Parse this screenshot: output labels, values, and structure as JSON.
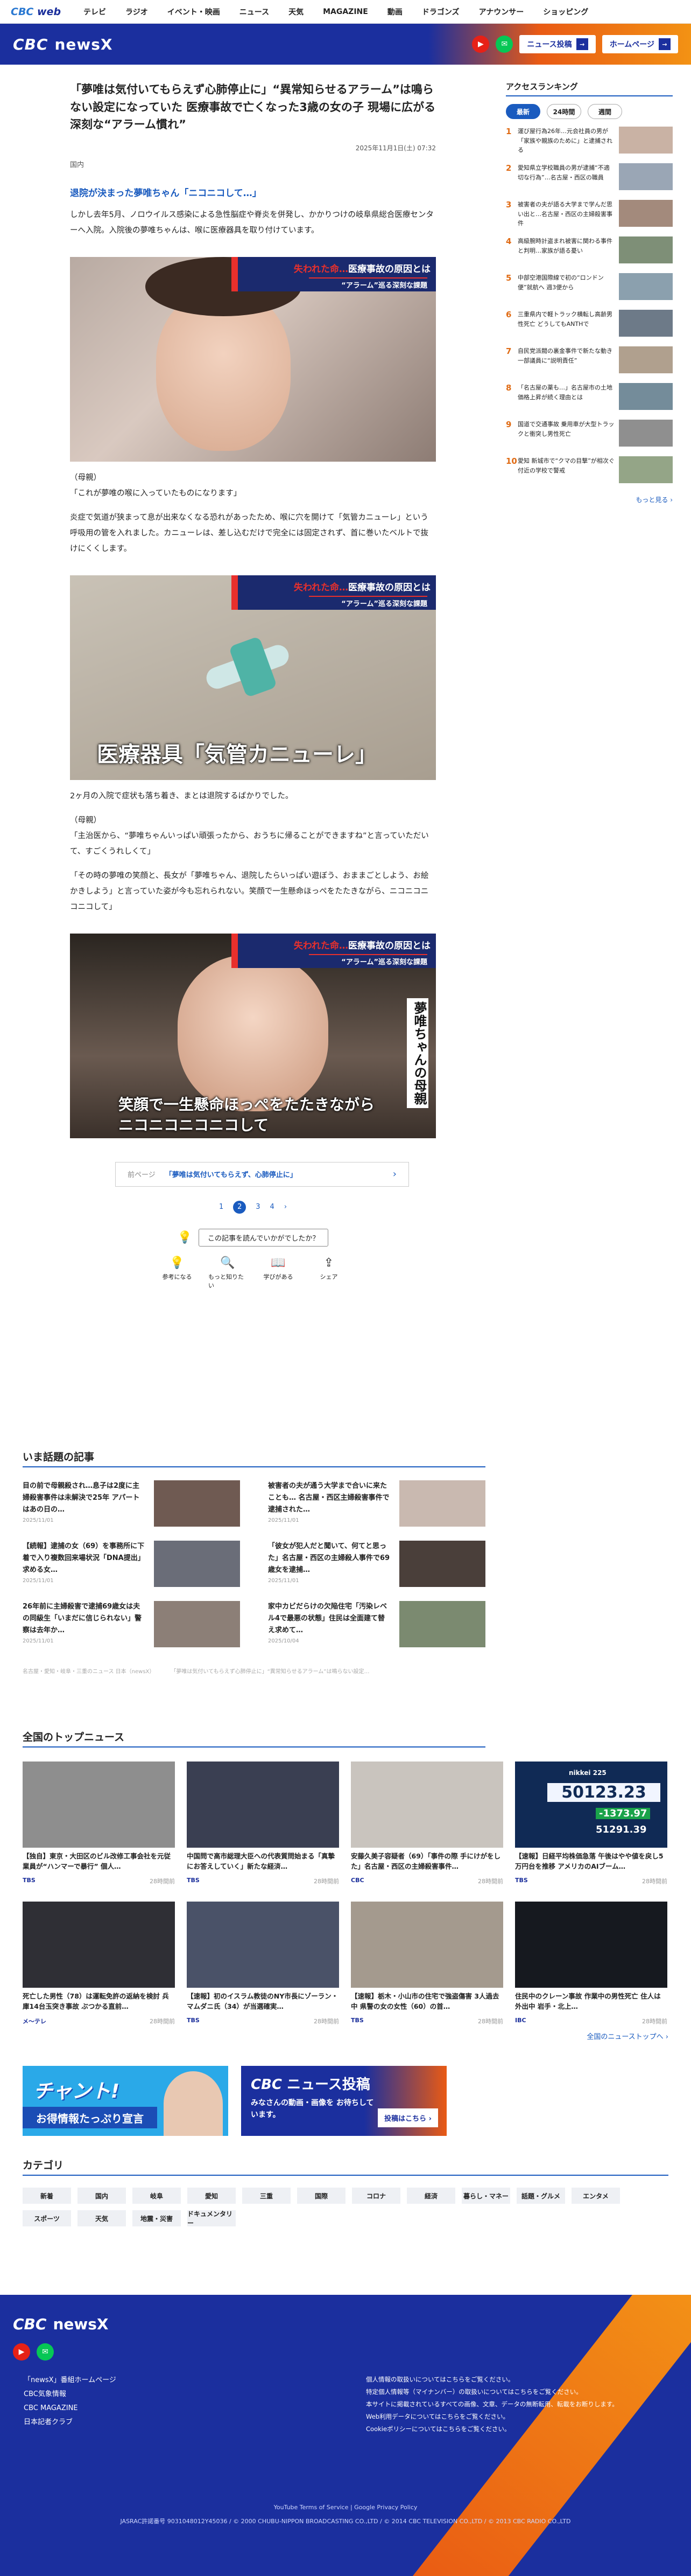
{
  "topbar": {
    "logo_main": "CBC",
    "logo_sub": "web",
    "nav": [
      "テレビ",
      "ラジオ",
      "イベント・映画",
      "ニュース",
      "天気",
      "MAGAZINE",
      "動画",
      "ドラゴンズ",
      "アナウンサー",
      "ショッピング"
    ]
  },
  "header": {
    "brand": "CBC",
    "brand_sub": "newsX",
    "post_button": "ニュース投稿",
    "home_button": "ホームページ"
  },
  "article": {
    "title": "「夢唯は気付いてもらえず心肺停止に」“異常知らせるアラーム”は鳴らない設定になっていた 医療事故で亡くなった3歳の女の子 現場に広がる深刻な“アラーム慣れ”",
    "date": "2025年11月1日(土) 07:32",
    "source": "国内",
    "lead": "退院が決まった夢唯ちゃん「ニコニコして…」",
    "p1": "しかし去年5月、ノロウイルス感染による急性脳症や脊炎を併発し、かかりつけの岐阜県総合医療センターへ入院。入院後の夢唯ちゃんは、喉に医療器具を取り付けています。",
    "photo1_banner_a": "失われた命…",
    "photo1_banner_b": "医療事故の原因とは",
    "photo1_banner_c": "“アラーム”巡る深刻な課題",
    "p2": "（母親）\n「これが夢唯の喉に入っていたものになります」",
    "p3": "炎症で気道が狭まって息が出来なくなる恐れがあったため、喉に穴を開けて「気管カニューレ」という呼吸用の管を入れました。カニューレは、差し込むだけで完全には固定されず、首に巻いたベルトで抜けにくくします。",
    "photo2_caption": "医療器具「気管カニューレ」",
    "p4": "2ヶ月の入院で症状も落ち着き、まとは退院するばかりでした。",
    "p5": "（母親）\n「主治医から、“夢唯ちゃんいっぱい頑張ったから、おうちに帰ることができますね”と言っていただいて、すごくうれしくて」",
    "p6": "「その時の夢唯の笑顔と、長女が「夢唯ちゃん、退院したらいっぱい遊ぼう、おままごとしよう、お絵かきしよう」と言っていた姿が今も忘れられない。笑顔で一生懸命ほっぺをたたきながら、ニコニコニコニコして」",
    "photo3_caption_a": "笑顔で一生懸命ほっぺをたたきながら",
    "photo3_caption_b": "ニコニコニコニコして",
    "photo3_side": "夢唯ちゃんの母親",
    "prev_label": "前ページ",
    "prev_text": "「夢唯は気付いてもらえず、心肺停止に」",
    "pages": [
      "1",
      "2",
      "3",
      "4",
      "›"
    ],
    "question": "この記事を読んでいかがでしたか？",
    "reactions": [
      {
        "icon": "💡",
        "label": "参考になる"
      },
      {
        "icon": "🔍",
        "label": "もっと知りたい"
      },
      {
        "icon": "📖",
        "label": "学びがある"
      },
      {
        "icon": "⇪",
        "label": "シェア"
      }
    ]
  },
  "sidebar": {
    "title": "アクセスランキング",
    "tabs": [
      "最新",
      "24時間",
      "週間"
    ],
    "items": [
      {
        "n": "1",
        "text": "運び屋行為26年…元会社員の男が「家族や親族のために」と逮捕される"
      },
      {
        "n": "2",
        "text": "愛知県立学校職員の男が逮捕“不適切な行為”…名古屋・西区の職員"
      },
      {
        "n": "3",
        "text": "被害者の夫が語る大学まで学んだ思い出と…名古屋・西区の主婦殺害事件"
      },
      {
        "n": "4",
        "text": "高級腕時計盗まれ被害に関わる事件と判明…家族が語る憂い"
      },
      {
        "n": "5",
        "text": "中部空港国際線で初の“ロンドン便”就航へ 週3便から"
      },
      {
        "n": "6",
        "text": "三重県内で軽トラック横転し高齢男性死亡 どうしてもANTHで"
      },
      {
        "n": "7",
        "text": "自民党派閥の裏金事件で新たな動き 一部議員に“説明責任”"
      },
      {
        "n": "8",
        "text": "「名古屋の薬も…」名古屋市の土地価格上昇が続く理由とは"
      },
      {
        "n": "9",
        "text": "国道で交通事故 乗用車が大型トラックと衝突し男性死亡"
      },
      {
        "n": "10",
        "text": "愛知 新城市で“クマの目撃”が相次ぐ 付近の学校で警戒"
      }
    ],
    "more": "もっと見る ›"
  },
  "wadai": {
    "title": "いま話題の記事",
    "items": [
      {
        "text": "目の前で母親殺され…息子は2度に主婦殺害事件は未解決で25年 アパートはあの日の…",
        "date": "2025/11/01"
      },
      {
        "text": "被害者の夫が通う大学まで合いに来たことも… 名古屋・西区主婦殺害事件で逮捕された…",
        "date": "2025/11/01"
      },
      {
        "text": "【続報】逮捕の女（69）を事務所に下着で入り複数回来場状況「DNA提出」求める女…",
        "date": "2025/11/01"
      },
      {
        "text": "「彼女が犯人だと聞いて、何てと思った」名古屋・西区の主婦殺人事件で69歳女を逮捕…",
        "date": "2025/11/01"
      },
      {
        "text": "26年前に主婦殺害で逮捕69歳女は夫の同級生「いまだに信じられない」警察は去年か…",
        "date": "2025/11/01"
      },
      {
        "text": "家中カビだらけの欠陥住宅「汚染レベル4で最悪の状態」住民は全面建て替え求めて…",
        "date": "2025/10/04"
      }
    ],
    "crumb": [
      "名古屋・愛知・岐阜・三重のニュース 日本（newsX）",
      "「夢唯は気付いてもらえず心肺停止に」“異常知らせるアラーム”は鳴らない設定…"
    ]
  },
  "topnews": {
    "title": "全国のトップニュース",
    "items": [
      {
        "text": "【独自】東京・大田区のビル改修工事会社を元従業員が“ハンマーで暴行” 個人…",
        "src": "TBS",
        "date": "28時間前"
      },
      {
        "text": "中国問で高市総理大臣への代表質問始まる「真摯にお答えしていく」新たな経済…",
        "src": "TBS",
        "date": "28時間前"
      },
      {
        "text": "安藤久美子容疑者（69）「事件の際 手にけがをした」名古屋・西区の主婦殺害事件…",
        "src": "CBC",
        "date": "28時間前"
      },
      {
        "text": "【速報】日経平均株価急落 午後はやや値を戻し5万円台を推移 アメリカのAIブーム…",
        "src": "TBS",
        "date": "28時間前"
      },
      {
        "text": "死亡した男性（78）は運転免許の返納を検討 兵庫14台玉突き事故 ぶつかる直前…",
        "src": "メ〜テレ",
        "date": "28時間前"
      },
      {
        "text": "【速報】初のイスラム教徒のNY市長にゾーラン・マムダニ氏（34）が当選確実…",
        "src": "TBS",
        "date": "28時間前"
      },
      {
        "text": "【速報】栃木・小山市の住宅で強盗傷害 3人過去中 県警の女の女性（60）の首…",
        "src": "TBS",
        "date": "28時間前"
      },
      {
        "text": "住民中のクレーン事故 作業中の男性死亡 住人は外出中 岩手・北上…",
        "src": "IBC",
        "date": "28時間前"
      }
    ],
    "ticker": "nikkei 225",
    "ticker_value": "50123.23",
    "ticker_change": "-1373.97",
    "ticker_sub": "51291.39",
    "more": "全国のニューストップへ ›"
  },
  "banners": {
    "b1_text": "チャント!",
    "b1_sub": "お得情報たっぷり宣言",
    "b2_brand": "CBC",
    "b2_text": "ニュース投稿",
    "b2_sub": "みなさんの動画・画像を お待ちしています。",
    "b2_btn": "投稿はこちら ›"
  },
  "categories": {
    "title": "カテゴリ",
    "items": [
      "新着",
      "国内",
      "岐阜",
      "愛知",
      "三重",
      "国際",
      "コロナ",
      "経済",
      "暮らし・マネー",
      "話題・グルメ",
      "エンタメ",
      "スポーツ",
      "天気",
      "地震・災害",
      "ドキュメンタリー"
    ]
  },
  "footer": {
    "brand": "CBC",
    "brand_sub": "newsX",
    "links": [
      "「newsX」番組ホームページ",
      "CBC気象情報",
      "CBC MAGAZINE",
      "日本記者クラブ"
    ],
    "right_links": [
      "個人情報の取扱いについてはこちらをご覧ください。",
      "特定個人情報等（マイナンバー）の取扱いについてはこちらをご覧ください。",
      "本サイトに掲載されているすべての画像、文章、データの無断転用、転載をお断りします。",
      "Web利用データについてはこちらをご覧ください。",
      "Cookieポリシーについてはこちらをご覧ください。"
    ],
    "terms": "YouTube Terms of Service | Google Privacy Policy",
    "copyright": "JASRAC許諾番号 9031048012Y45036 / © 2000 CHUBU-NIPPON BROADCASTING CO.,LTD / © 2014 CBC TELEVISION CO.,LTD / © 2013 CBC RADIO CO.,LTD"
  },
  "colors": {
    "brand": "#1b2f9e",
    "accent": "#e95a14",
    "link": "#1a5bbf"
  }
}
